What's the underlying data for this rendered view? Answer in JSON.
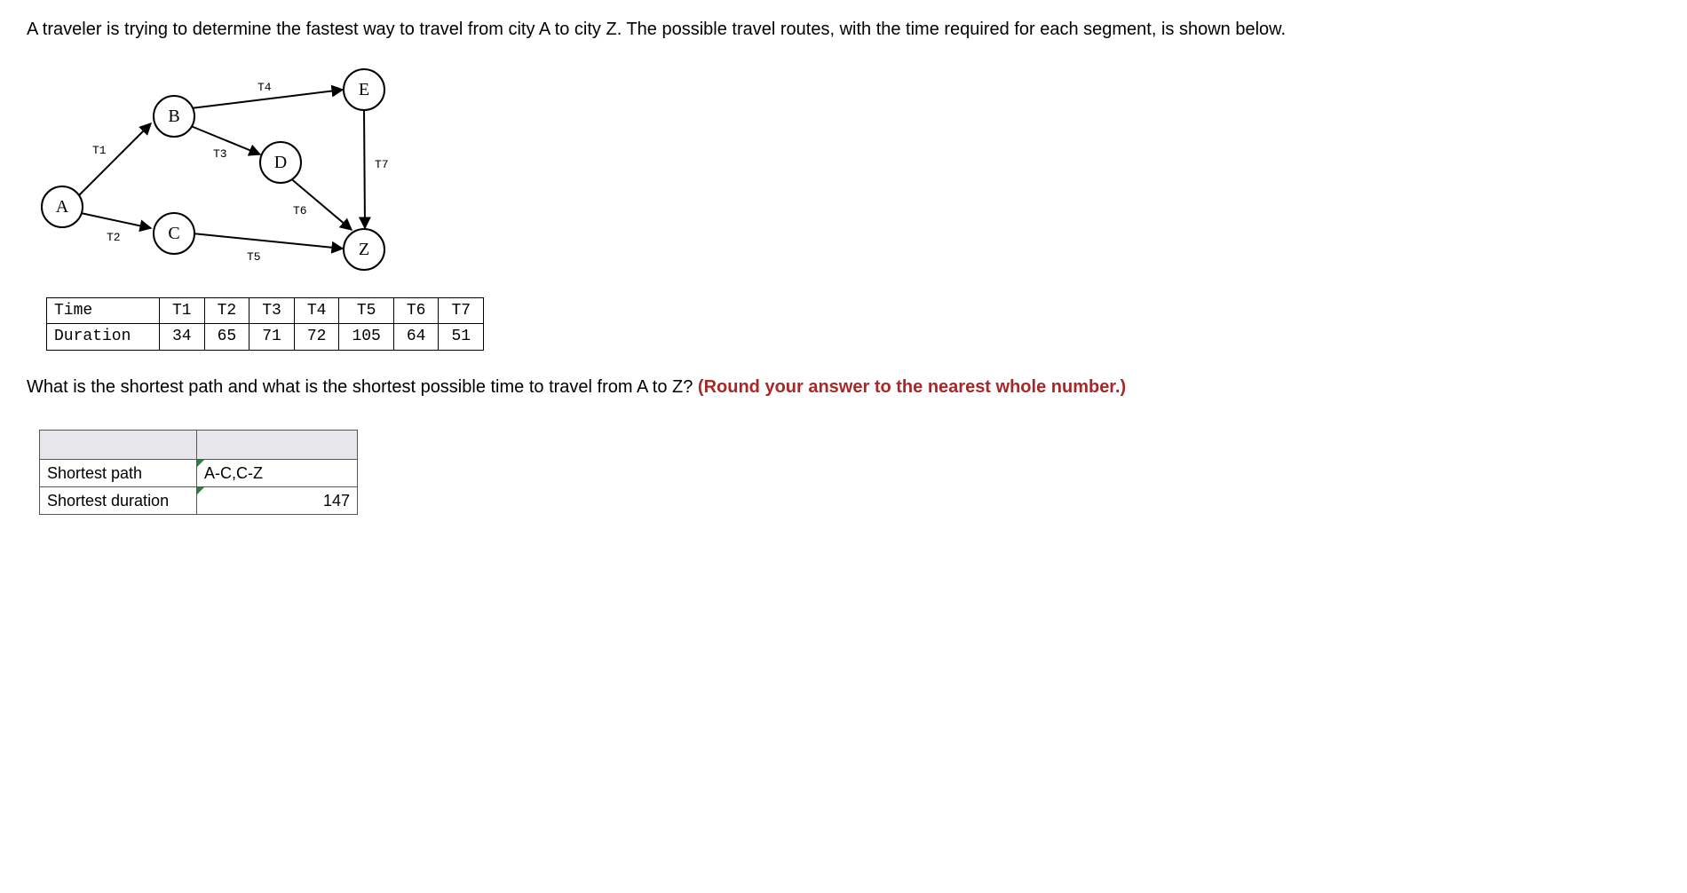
{
  "intro": "A traveler is trying to determine the fastest way to travel from city A to city Z. The possible travel routes, with the time required for each segment, is shown below.",
  "graph": {
    "nodes": {
      "A": "A",
      "B": "B",
      "C": "C",
      "D": "D",
      "E": "E",
      "Z": "Z"
    },
    "edges": {
      "T1": "T1",
      "T2": "T2",
      "T3": "T3",
      "T4": "T4",
      "T5": "T5",
      "T6": "T6",
      "T7": "T7"
    }
  },
  "table": {
    "row1_label": "Time",
    "row2_label": "Duration",
    "cols": [
      "T1",
      "T2",
      "T3",
      "T4",
      "T5",
      "T6",
      "T7"
    ],
    "durations": [
      "34",
      "65",
      "71",
      "72",
      "105",
      "64",
      "51"
    ]
  },
  "question_prefix": "What is the shortest path and what is the shortest possible time to travel from A to Z? ",
  "question_bold": "(Round your answer to the nearest whole number.)",
  "answers": {
    "path_label": "Shortest path",
    "path_value": "A-C,C-Z",
    "duration_label": "Shortest duration",
    "duration_value": "147"
  }
}
